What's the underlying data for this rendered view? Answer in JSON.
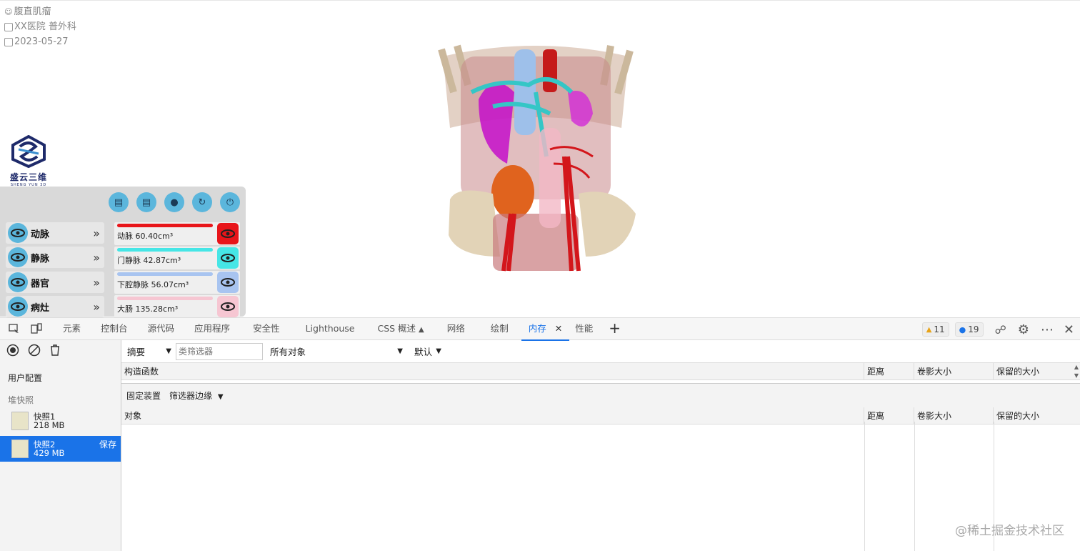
{
  "app": {
    "patient": "腹直肌瘤",
    "hospital": "XX医院 普外科",
    "date": "2023-05-27",
    "logo_text": "盛云三维",
    "logo_sub": "SHENG YUN 3D",
    "toolbar_icons": [
      "document-icon",
      "file-icon",
      "bulb-icon",
      "reset-icon",
      "power-icon"
    ],
    "categories": [
      {
        "label": "动脉"
      },
      {
        "label": "静脉"
      },
      {
        "label": "器官"
      },
      {
        "label": "病灶"
      }
    ],
    "items": [
      {
        "label": "动脉 60.40cm³",
        "color": "#e8151a",
        "eye_bg": "#e8151a"
      },
      {
        "label": "门静脉 42.87cm³",
        "color": "#46e6e6",
        "eye_bg": "#46e6e6"
      },
      {
        "label": "下腔静脉 56.07cm³",
        "color": "#a8c4f0",
        "eye_bg": "#a8c4f0"
      },
      {
        "label": "大肠 135.28cm³",
        "color": "#f6c6d2",
        "eye_bg": "#f6c6d2"
      }
    ]
  },
  "devtools": {
    "tabs": [
      "元素",
      "控制台",
      "源代码",
      "应用程序",
      "安全性",
      "Lighthouse",
      "CSS 概述",
      "网络",
      "绘制",
      "内存",
      "性能"
    ],
    "active_tab": "内存",
    "warnings": "11",
    "messages": "19",
    "sidebar": {
      "profiles_heading": "用户配置",
      "heap_heading": "堆快照",
      "snapshots": [
        {
          "name": "快照1",
          "size": "218 MB"
        },
        {
          "name": "快照2",
          "size": "429 MB",
          "save": "保存"
        }
      ]
    },
    "toolbar": {
      "view": "摘要",
      "class_filter_placeholder": "类筛选器",
      "objects": "所有对象",
      "default": "默认"
    },
    "table_top_headers": [
      "构造函数",
      "距离",
      "卷影大小",
      "保留的大小"
    ],
    "retainers": {
      "fixed": "固定装置",
      "filter_edges": "筛选器边缘"
    },
    "table_bottom_headers": [
      "对象",
      "距离",
      "卷影大小",
      "保留的大小"
    ],
    "watermark": "@稀土掘金技术社区"
  }
}
